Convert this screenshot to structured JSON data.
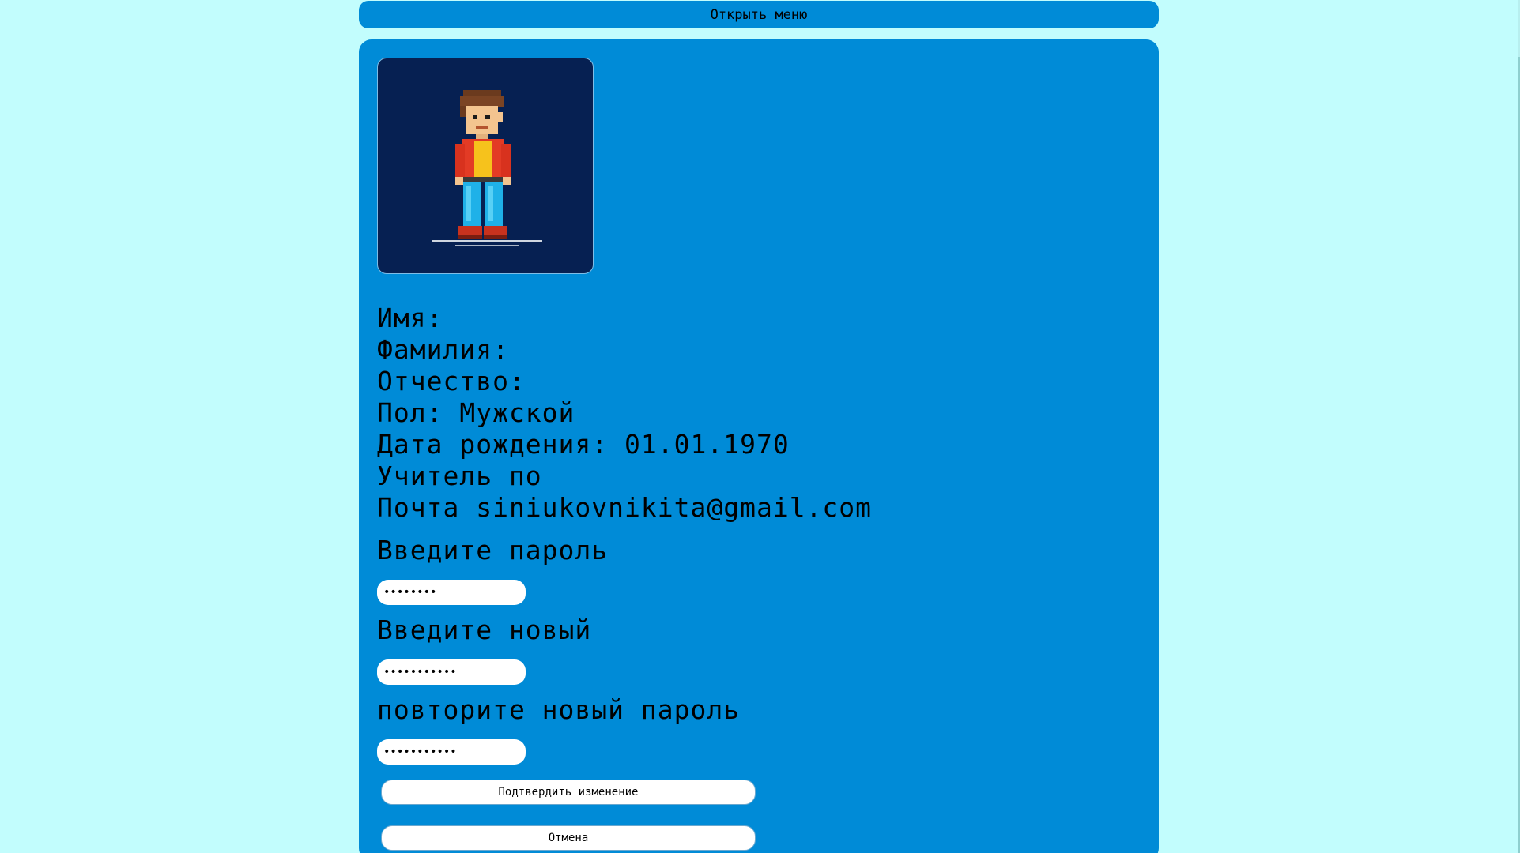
{
  "header": {
    "menu_button_label": "Открыть меню"
  },
  "profile": {
    "avatar_icon": "pixel-art-person-icon",
    "lines": [
      "Имя:",
      "Фамилия:",
      "Отчество:",
      "Пол: Мужской",
      "Дата рождения: 01.01.1970",
      "Учитель по",
      "Почта siniukovnikita@gmail.com"
    ]
  },
  "password_form": {
    "current_label": "Введите пароль",
    "current_value": "••••••••",
    "new_label": "Введите новый",
    "new_value": "•••••••••••",
    "repeat_label": "повторите новый пароль",
    "repeat_value": "•••••••••••",
    "confirm_label": "Подтвердить изменение",
    "cancel_label": "Отмена"
  },
  "colors": {
    "background": "#c2fdfd",
    "panel": "#008bd7",
    "avatar_bg": "#062052"
  }
}
